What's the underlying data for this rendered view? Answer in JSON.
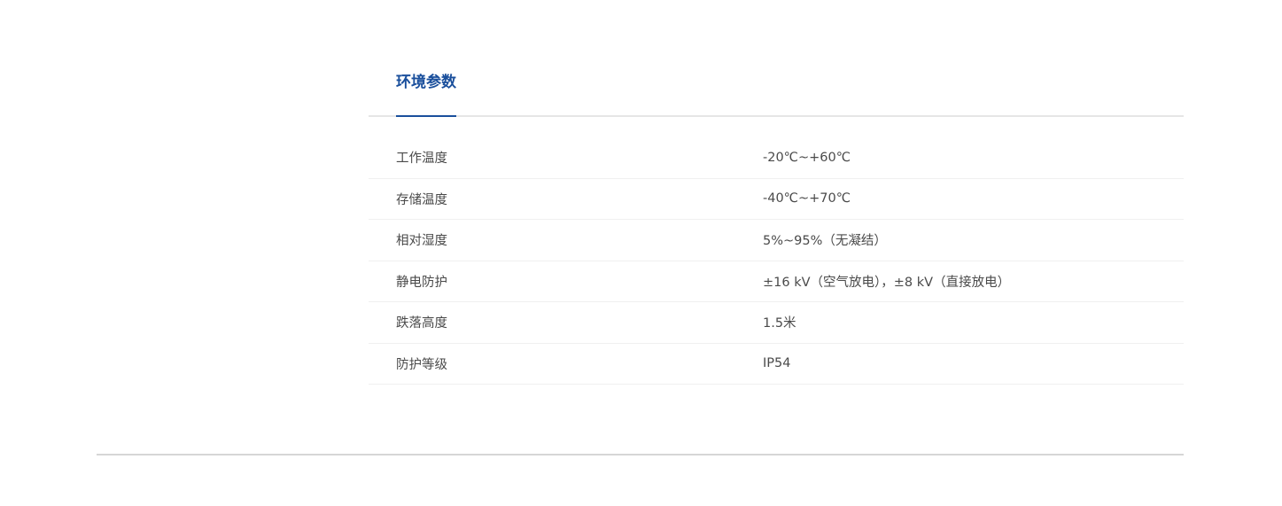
{
  "tabs": [
    {
      "label": "环境参数",
      "active": true
    }
  ],
  "specs": [
    {
      "label": "工作温度",
      "value": "-20℃~+60℃"
    },
    {
      "label": "存储温度",
      "value": "-40℃~+70℃"
    },
    {
      "label": "相对湿度",
      "value": "5%~95%（无凝结）"
    },
    {
      "label": "静电防护",
      "value": "±16 kV（空气放电），±8 kV（直接放电）"
    },
    {
      "label": "跌落高度",
      "value": "1.5米"
    },
    {
      "label": "防护等级",
      "value": "IP54"
    }
  ],
  "colors": {
    "accent": "#1a4f9c",
    "text": "#4a4a4a",
    "divider": "#e6e6e6",
    "row_divider": "#f0f0f0",
    "footer_divider": "#d6d6d6"
  }
}
